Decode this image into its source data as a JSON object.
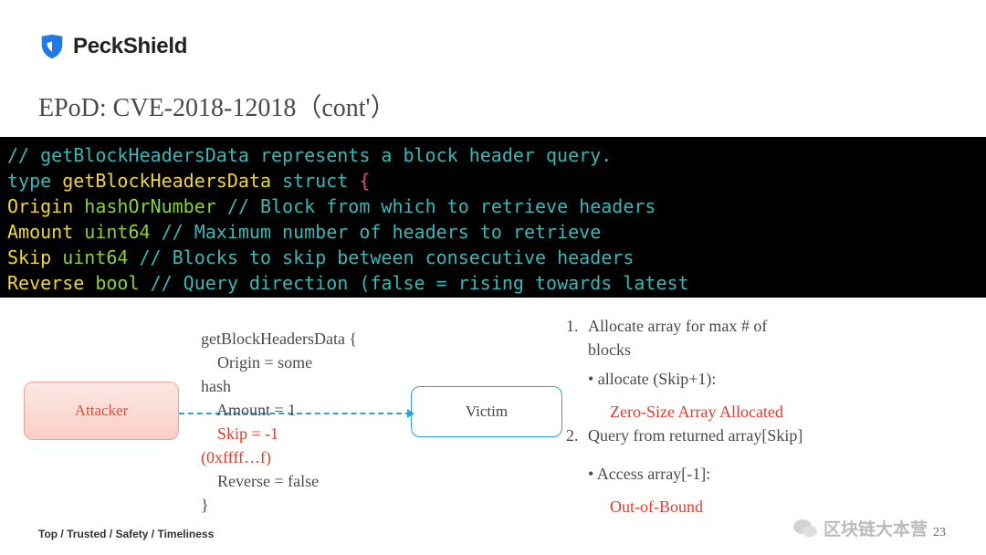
{
  "logo": {
    "brand": "PeckShield"
  },
  "title": "EPoD: CVE-2018-12018（cont'）",
  "code": {
    "cmt1": "// getBlockHeadersData represents a block header query.",
    "kw_type": "type",
    "typename": "getBlockHeadersData",
    "kw_struct": "struct",
    "brace_open": "{",
    "fields": [
      {
        "name": "Origin",
        "type": "hashOrNumber",
        "cmt": "// Block from which to retrieve headers"
      },
      {
        "name": "Amount",
        "type": "uint64",
        "cmt": "// Maximum number of headers to retrieve"
      },
      {
        "name": "Skip",
        "type": "uint64",
        "cmt": "// Blocks to skip between consecutive headers"
      },
      {
        "name": "Reverse",
        "type": "bool",
        "cmt": "// Query direction (false = rising towards latest"
      }
    ],
    "brace_close": "}"
  },
  "diagram": {
    "attacker": "Attacker",
    "victim": "Victim",
    "payload": {
      "head": "getBlockHeadersData {",
      "origin_l1": "    Origin = some",
      "origin_l2": "hash",
      "amount": "    Amount = 1",
      "skip": "    Skip = -1",
      "skip_hex": "(0xffff…f)",
      "reverse": "    Reverse = false",
      "tail": "}"
    }
  },
  "steps": {
    "s1_num": "1.",
    "s1_line1": "Allocate array for max # of",
    "s1_line2": "blocks",
    "s1_sub": "• allocate (Skip+1):",
    "s1_hl": "Zero-Size Array Allocated",
    "s2_num": "2.",
    "s2": "Query from returned array[Skip]",
    "s2_sub": "• Access array[-1]:",
    "s2_hl": "Out-of-Bound"
  },
  "footer": "Top / Trusted / Safety / Timeliness",
  "pagenum": "23",
  "watermark": "区块链大本营"
}
